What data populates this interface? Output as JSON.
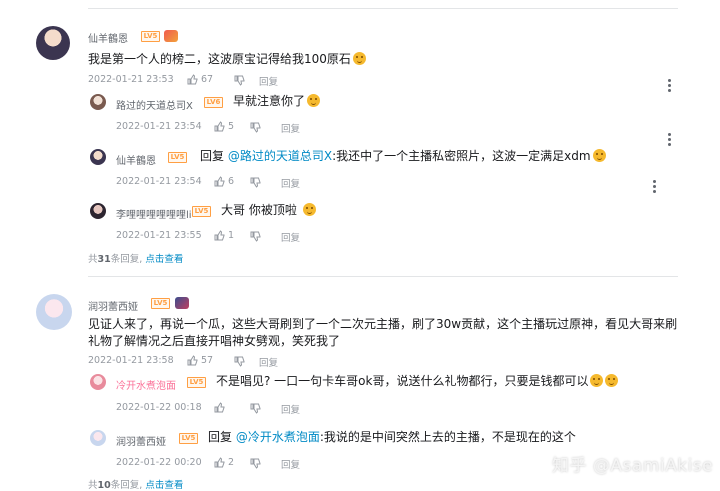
{
  "colors": {
    "accent": "#008ac5",
    "pink_name": "#fb7299",
    "level_badge": "#ff9f43"
  },
  "threads": [
    {
      "root": {
        "username": "仙羊鶴恩",
        "level": "LV5",
        "text": "我是第一个人的榜二，这波原宝记得给我100原石",
        "time": "2022-01-21 23:53",
        "likes": "67",
        "reply_label": "回复"
      },
      "replies": [
        {
          "username": "路过的天道总司X",
          "level": "LV6",
          "text": "早就注意你了",
          "time": "2022-01-21 23:54",
          "likes": "5",
          "reply_label": "回复"
        },
        {
          "username": "仙羊鶴恩",
          "level": "LV5",
          "prefix": "回复",
          "mention": "@路过的天道总司X",
          "text": ":我还中了一个主播私密照片，这波一定满足xdm",
          "time": "2022-01-21 23:54",
          "likes": "6",
          "reply_label": "回复"
        },
        {
          "username": "李哩哩哩哩哩哩li",
          "level": "LV5",
          "text": "大哥 你被顶啦",
          "time": "2022-01-21 23:55",
          "likes": "1",
          "reply_label": "回复"
        }
      ],
      "summary": {
        "prefix": "共",
        "count": "31",
        "suffix": "条回复,",
        "link": "点击查看"
      }
    },
    {
      "root": {
        "username": "润羽蕾西娅",
        "level": "LV5",
        "text": "见证人来了，再说一个瓜，这些大哥刷到了一个二次元主播，刷了30w贡献，这个主播玩过原神，看见大哥来刷礼物了解情况之后直接开唱神女劈观，笑死我了",
        "time": "2022-01-21 23:58",
        "likes": "57",
        "reply_label": "回复"
      },
      "replies": [
        {
          "username": "冷开水煮泡面",
          "level": "LV5",
          "text": "不是唱见? 一口一句卡车哥ok哥，说送什么礼物都行，只要是钱都可以",
          "time": "2022-01-22 00:18",
          "likes": "",
          "reply_label": "回复"
        },
        {
          "username": "润羽蕾西娅",
          "level": "LV5",
          "prefix": "回复",
          "mention": "@冷开水煮泡面",
          "text": ":我说的是中间突然上去的主播，不是现在的这个",
          "time": "2022-01-22 00:20",
          "likes": "2",
          "reply_label": "回复"
        }
      ],
      "summary": {
        "prefix": "共",
        "count": "10",
        "suffix": "条回复,",
        "link": "点击查看"
      }
    }
  ],
  "watermark": "知乎 @AsamiAkise",
  "icons": [
    "like-icon",
    "dislike-icon",
    "more-icon",
    "emoji-icon",
    "avatar",
    "level-badge",
    "fan-medal"
  ]
}
